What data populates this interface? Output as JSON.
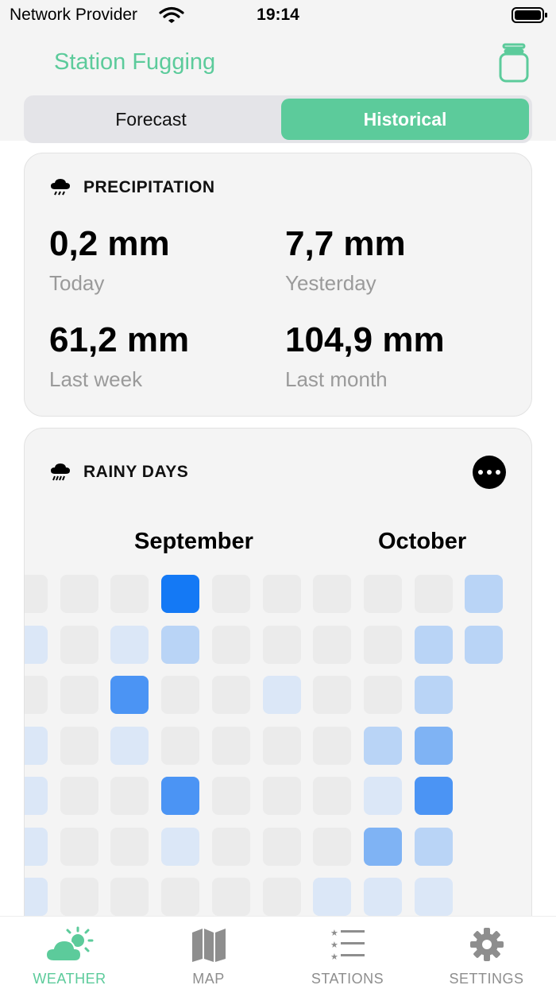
{
  "status": {
    "provider": "Network Provider",
    "time": "19:14"
  },
  "header": {
    "title": "Station Fugging",
    "segments": [
      "Forecast",
      "Historical"
    ],
    "selected_segment": "Historical"
  },
  "precipitation": {
    "title": "PRECIPITATION",
    "stats": [
      {
        "value": "0,2 mm",
        "label": "Today"
      },
      {
        "value": "7,7 mm",
        "label": "Yesterday"
      },
      {
        "value": "61,2 mm",
        "label": "Last week"
      },
      {
        "value": "104,9 mm",
        "label": "Last month"
      }
    ]
  },
  "rainy_days": {
    "title": "RAINY DAYS",
    "months": [
      "September",
      "October"
    ],
    "legend_scale_note": "cell intensity levels 0-5",
    "levels": [
      [
        0,
        0,
        0,
        5,
        0,
        0,
        0,
        0,
        0,
        2
      ],
      [
        1,
        0,
        1,
        2,
        0,
        0,
        0,
        0,
        2,
        2
      ],
      [
        0,
        0,
        4,
        0,
        0,
        1,
        0,
        0,
        2,
        null
      ],
      [
        1,
        0,
        1,
        0,
        0,
        0,
        0,
        2,
        3,
        null
      ],
      [
        1,
        0,
        0,
        4,
        0,
        0,
        0,
        1,
        4,
        null
      ],
      [
        1,
        0,
        0,
        1,
        0,
        0,
        0,
        3,
        2,
        null
      ],
      [
        1,
        0,
        0,
        0,
        0,
        0,
        1,
        1,
        1,
        null
      ]
    ]
  },
  "tabs": [
    {
      "label": "WEATHER",
      "active": true
    },
    {
      "label": "MAP",
      "active": false
    },
    {
      "label": "STATIONS",
      "active": false
    },
    {
      "label": "SETTINGS",
      "active": false
    }
  ],
  "colors": {
    "accent": "#5ccb9b",
    "level_0": "#ebebeb",
    "level_1": "#dbe7f7",
    "level_2": "#b9d4f6",
    "level_3": "#7fb3f4",
    "level_4": "#4b94f4",
    "level_5": "#1479f5"
  }
}
